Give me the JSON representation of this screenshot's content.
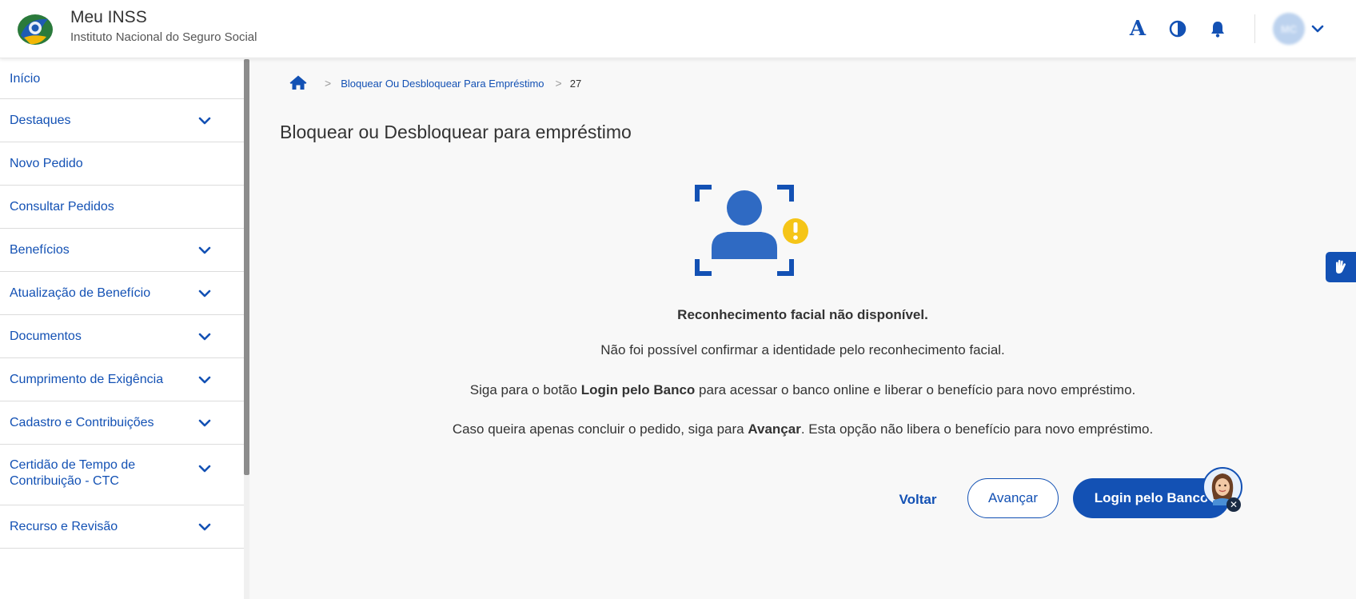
{
  "header": {
    "app_title": "Meu INSS",
    "app_subtitle": "Instituto Nacional do Seguro Social",
    "font_button_label": "A",
    "avatar_initials": "MC",
    "icons": [
      "font-size-icon",
      "contrast-icon",
      "bell-icon",
      "chevron-down-icon"
    ]
  },
  "sidebar": {
    "items": [
      {
        "label": "Início",
        "expandable": false
      },
      {
        "label": "Destaques",
        "expandable": true
      },
      {
        "label": "Novo Pedido",
        "expandable": false
      },
      {
        "label": "Consultar Pedidos",
        "expandable": false
      },
      {
        "label": "Benefícios",
        "expandable": true
      },
      {
        "label": "Atualização de Benefício",
        "expandable": true
      },
      {
        "label": "Documentos",
        "expandable": true
      },
      {
        "label": "Cumprimento de Exigência",
        "expandable": true
      },
      {
        "label": "Cadastro e Contribuições",
        "expandable": true
      },
      {
        "label": "Certidão de Tempo de Contribuição - CTC",
        "expandable": true
      },
      {
        "label": "Recurso e Revisão",
        "expandable": true
      }
    ]
  },
  "breadcrumb": {
    "link": "Bloquear Ou Desbloquear Para Empréstimo",
    "current": "27"
  },
  "main": {
    "page_title": "Bloquear ou Desbloquear para empréstimo",
    "message_title": "Reconhecimento facial não disponível.",
    "line1": "Não foi possível confirmar a identidade pelo reconhecimento facial.",
    "line2_prefix": "Siga para o botão ",
    "line2_bold": "Login pelo Banco",
    "line2_suffix": " para acessar o banco online e liberar o benefício para novo empréstimo.",
    "line3_prefix": "Caso queira apenas concluir o pedido, siga para ",
    "line3_bold": "Avançar",
    "line3_suffix": ". Esta opção não libera o benefício para novo empréstimo."
  },
  "actions": {
    "voltar_label": "Voltar",
    "avancar_label": "Avançar",
    "login_label": "Login pelo Banco"
  },
  "colors": {
    "primary": "#1351b4",
    "warning": "#f5c518",
    "text": "#333333",
    "background_main": "#f8f8f8"
  }
}
